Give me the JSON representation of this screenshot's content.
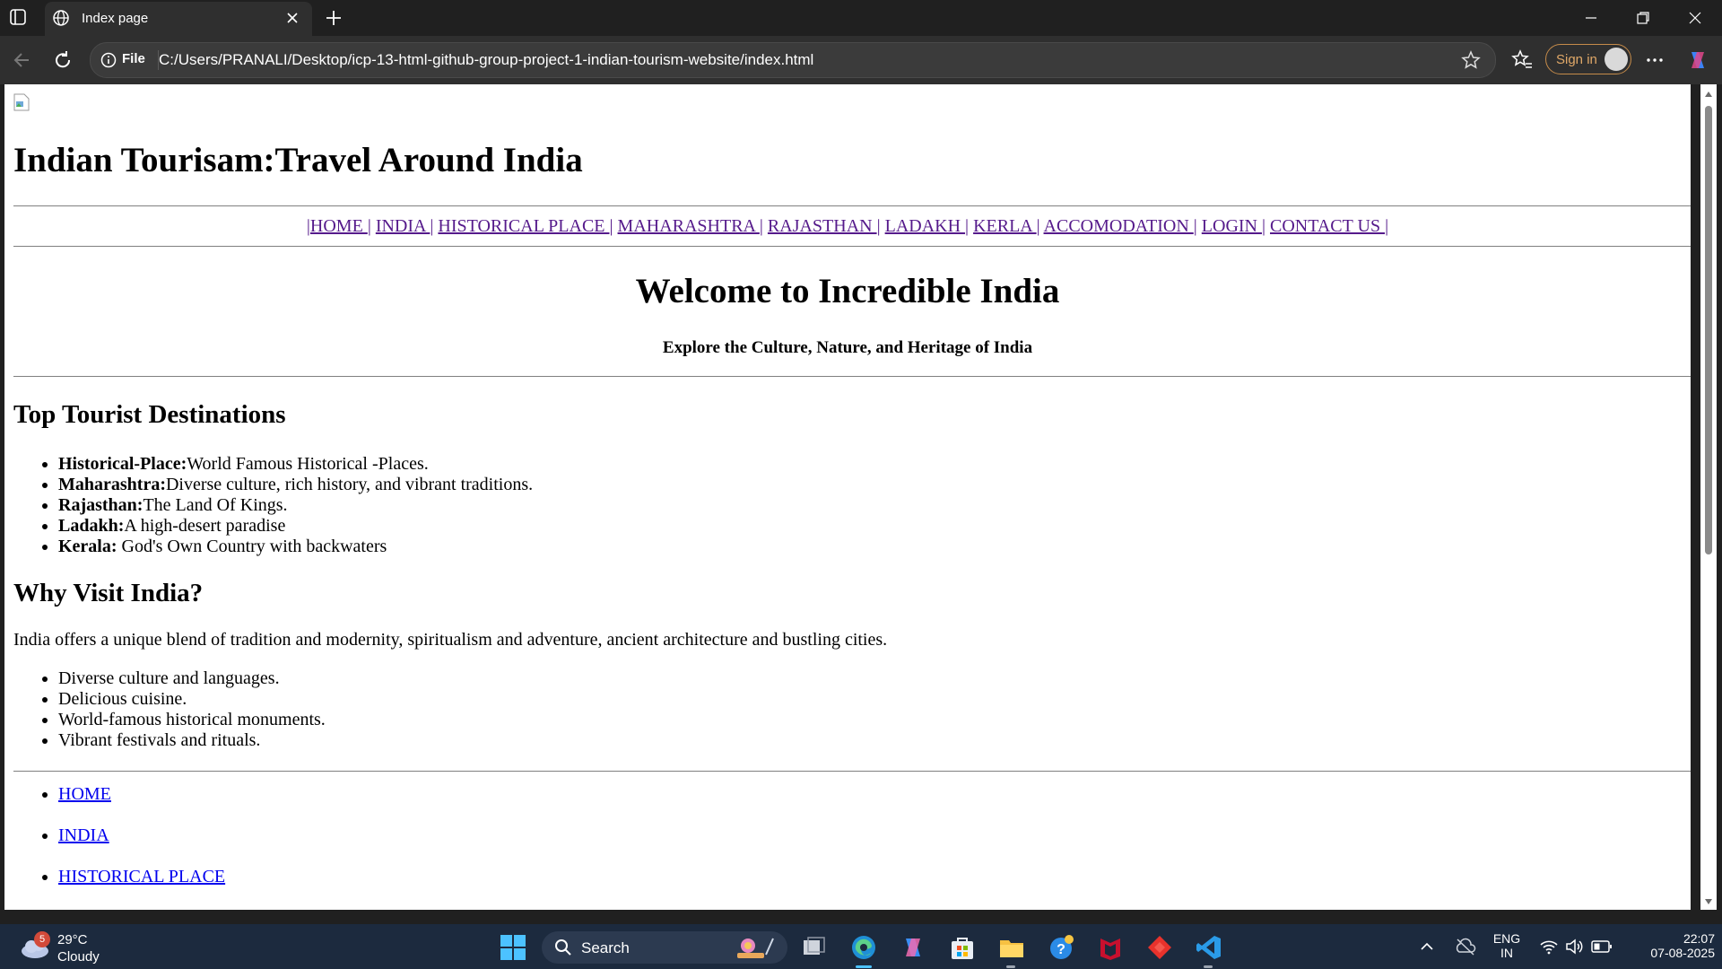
{
  "browser": {
    "tab_title": "Index page",
    "omnibox_scheme": "File",
    "url": "C:/Users/PRANALI/Desktop/icp-13-html-github-group-project-1-indian-tourism-website/index.html",
    "sign_in_label": "Sign in"
  },
  "page": {
    "site_title": "Indian Tourisam:Travel Around India",
    "nav": [
      "HOME ",
      "INDIA ",
      "HISTORICAL PLACE ",
      "MAHARASHTRA ",
      "RAJASTHAN ",
      "LADAKH ",
      "KERLA ",
      "ACCOMODATION ",
      "LOGIN ",
      "CONTACT US "
    ],
    "welcome_heading": "Welcome to Incredible India",
    "tagline": "Explore the Culture, Nature, and Heritage of India",
    "destinations_heading": "Top Tourist Destinations",
    "destinations": [
      {
        "name": "Historical-Place:",
        "desc": "World Famous Historical -Places."
      },
      {
        "name": "Maharashtra:",
        "desc": "Diverse culture, rich history, and vibrant traditions."
      },
      {
        "name": "Rajasthan:",
        "desc": "The Land Of Kings."
      },
      {
        "name": "Ladakh:",
        "desc": "A high-desert paradise"
      },
      {
        "name": "Kerala:",
        "desc": " God's Own Country with backwaters"
      }
    ],
    "why_heading": "Why Visit India?",
    "why_paragraph": "India offers a unique blend of tradition and modernity, spiritualism and adventure, ancient architecture and bustling cities.",
    "why_points": [
      "Diverse culture and languages.",
      "Delicious cuisine.",
      "World-famous historical monuments.",
      "Vibrant festivals and rituals."
    ],
    "footer_links": [
      "HOME",
      "INDIA",
      "HISTORICAL PLACE"
    ]
  },
  "taskbar": {
    "weather_temp": "29°C",
    "weather_cond": "Cloudy",
    "weather_badge": "5",
    "search_label": "Search",
    "lang_top": "ENG",
    "lang_bottom": "IN",
    "time": "22:07",
    "date": "07-08-2025"
  },
  "colors": {
    "visited_link": "#551a8b",
    "link": "#0000ee",
    "taskbar_bg": "#1c2a3e"
  }
}
